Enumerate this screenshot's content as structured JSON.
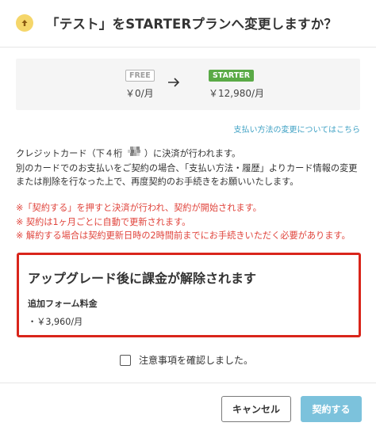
{
  "header": {
    "icon": "arrow-up-circle-icon",
    "title": "「テスト」をSTARTERプランへ変更しますか？"
  },
  "plans": {
    "current_badge": "FREE",
    "current_price": "￥0/月",
    "arrow_icon": "arrow-right-icon",
    "new_badge": "STARTER",
    "new_price": "￥12,980/月"
  },
  "payment_link": "支払い方法の変更についてはこちら",
  "info": {
    "line1_before": "クレジットカード（下４桁 ",
    "line1_after": "）に決済が行われます。",
    "line2": "別のカードでのお支払いをご契約の場合、「支払い方法・履歴」よりカード情報の変更",
    "line3": "または削除を行なった上で、再度契約のお手続きをお願いいたします。"
  },
  "notes": [
    "※「契約する」を押すと決済が行われ、契約が開始されます。",
    "※ 契約は1ヶ月ごとに自動で更新されます。",
    "※ 解約する場合は契約更新日時の2時間前までにお手続きいただく必要があります。"
  ],
  "alert": {
    "title": "アップグレード後に課金が解除されます",
    "subtitle": "追加フォーム料金",
    "price": "・￥3,960/月"
  },
  "confirm_label": "注意事項を確認しました。",
  "buttons": {
    "cancel": "キャンセル",
    "submit": "契約する"
  },
  "colors": {
    "starter_green": "#5aaa46",
    "link_blue": "#3fa1c4",
    "notice_red": "#e0443c",
    "alert_border": "#d9251b",
    "submit_button": "#7cc2dc"
  }
}
